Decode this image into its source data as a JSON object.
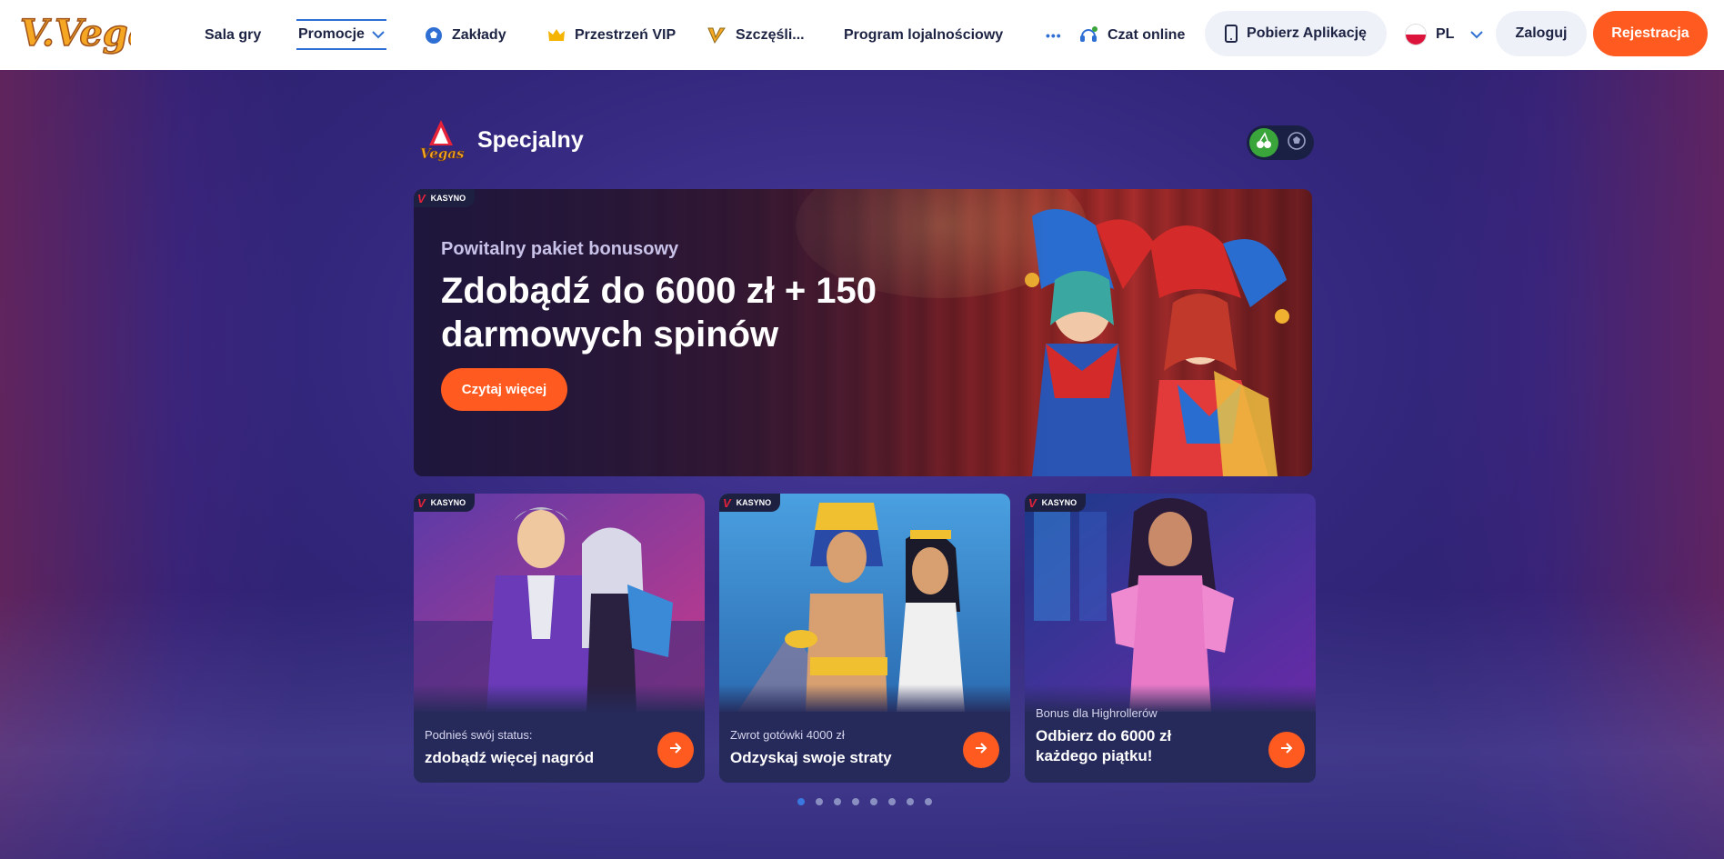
{
  "header": {
    "logo_text": "V.Vegas",
    "nav": [
      {
        "label": "Sala gry"
      },
      {
        "label": "Promocje"
      },
      {
        "label": "Zakłady"
      },
      {
        "label": "Przestrzeń VIP"
      },
      {
        "label": "Szczęśli..."
      },
      {
        "label": "Program lojalnościowy"
      }
    ],
    "more_label": "•••",
    "chat_label": "Czat online",
    "app_label": "Pobierz Aplikację",
    "lang_label": "PL",
    "login_label": "Zaloguj",
    "register_label": "Rejestracja"
  },
  "section": {
    "logo_text": "Vegas",
    "title": "Specjalny",
    "toggle": {
      "active": "casino-icon",
      "inactive": "soccer-ball-icon"
    }
  },
  "hero": {
    "tag": "KASYNO",
    "subtitle": "Powitalny pakiet bonusowy",
    "title": "Zdobądź do 6000 zł + 150 darmowych spinów",
    "button": "Czytaj więcej"
  },
  "cards": [
    {
      "tag": "KASYNO",
      "subtitle": "Podnieś swój status:",
      "title": "zdobądź więcej nagród"
    },
    {
      "tag": "KASYNO",
      "subtitle": "Zwrot gotówki 4000 zł",
      "title": "Odzyskaj swoje straty"
    },
    {
      "tag": "KASYNO",
      "subtitle": "Bonus dla Highrollerów",
      "title": "Odbierz do 6000 zł każdego piątku!"
    }
  ],
  "carousel": {
    "pages": 8,
    "active_index": 0
  },
  "colors": {
    "accent": "#ff5a1f",
    "active_nav": "#2f6fd4",
    "toggle_on": "#3aa53a"
  }
}
